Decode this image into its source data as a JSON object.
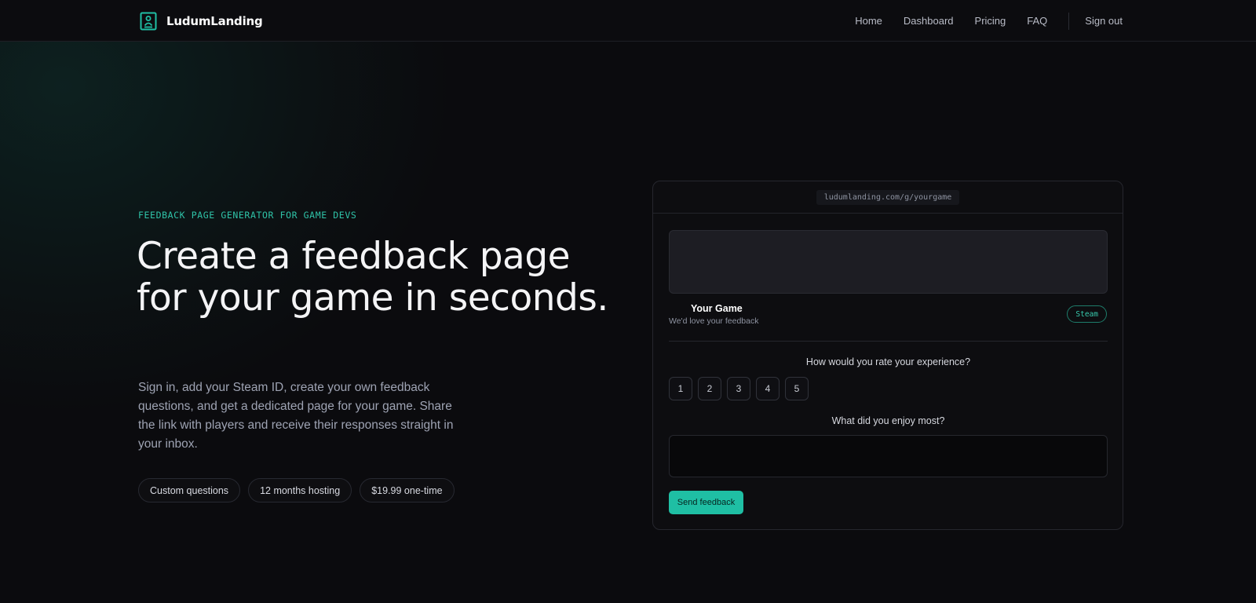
{
  "brand": {
    "name": "LudumLanding",
    "logo_icon": "document-person-icon",
    "accent_color": "#1fbfa4"
  },
  "nav": {
    "items": [
      {
        "label": "Home"
      },
      {
        "label": "Dashboard"
      },
      {
        "label": "Pricing"
      },
      {
        "label": "FAQ"
      }
    ],
    "sign_out": "Sign out"
  },
  "hero": {
    "eyebrow": "FEEDBACK PAGE GENERATOR FOR GAME DEVS",
    "title": "Create a feedback page for your game in seconds.",
    "description": "Sign in, add your Steam ID, create your own feedback questions, and get a dedicated page for your game. Share the link with players and receive their responses straight in your inbox.",
    "pills": [
      {
        "label": "Custom questions"
      },
      {
        "label": "12 months hosting"
      },
      {
        "label": "$19.99 one-time"
      }
    ]
  },
  "preview": {
    "url": "ludumlanding.com/g/yourgame",
    "game_title": "Your Game",
    "game_subtitle": "We'd love your feedback",
    "platform_badge": "Steam",
    "question_rating": "How would you rate your experience?",
    "rating_options": [
      "1",
      "2",
      "3",
      "4",
      "5"
    ],
    "question_text": "What did you enjoy most?",
    "answer_value": "",
    "submit_label": "Send feedback"
  }
}
